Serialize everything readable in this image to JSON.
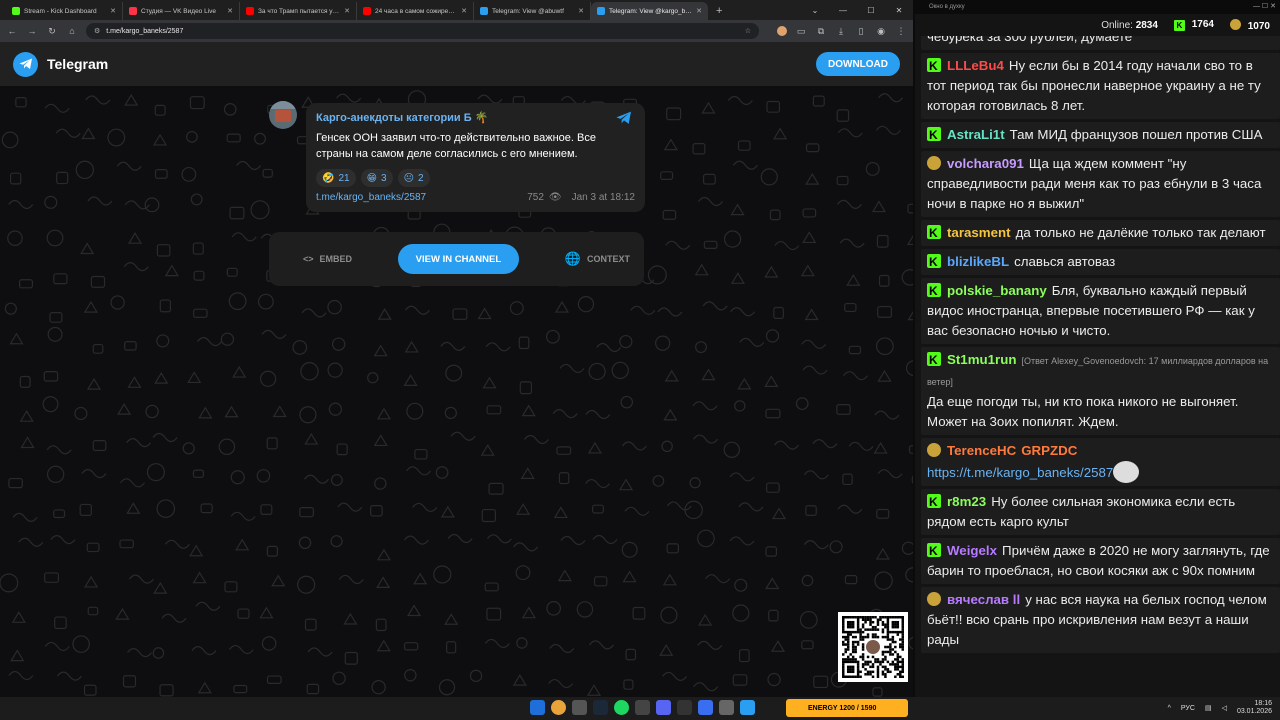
{
  "browser": {
    "tabs": [
      {
        "title": "Stream - Kick Dashboard",
        "color": "#53fc18",
        "active": false
      },
      {
        "title": "Студия — VK Видео Live",
        "color": "#ff3347",
        "active": false
      },
      {
        "title": "За что Трамп пытается убить",
        "color": "#ff0000",
        "active": false
      },
      {
        "title": "24 часа в самом сожиревшем",
        "color": "#ff0000",
        "active": false
      },
      {
        "title": "Telegram: View @abuwtf",
        "color": "#2a9ef1",
        "active": false
      },
      {
        "title": "Telegram: View @kargo_baneks",
        "color": "#2a9ef1",
        "active": true
      }
    ],
    "url": "t.me/kargo_baneks/2587"
  },
  "telegram": {
    "brand": "Telegram",
    "download_label": "DOWNLOAD",
    "post": {
      "channel": "Карго-анекдоты категории Б 🌴",
      "text": "Генсек ООН заявил что-то действительно важное. Все страны на самом деле согласились с его мнением.",
      "reactions": [
        {
          "emoji": "🤣",
          "count": "21"
        },
        {
          "emoji": "😁",
          "count": "3"
        },
        {
          "emoji": "😐",
          "count": "2"
        }
      ],
      "link": "t.me/kargo_baneks/2587",
      "views": "752",
      "date": "Jan 3 at 18:12"
    },
    "actions": {
      "embed": "EMBED",
      "view": "VIEW IN CHANNEL",
      "context": "CONTEXT"
    }
  },
  "chat": {
    "window_title": "Окно в духку",
    "online_label": "Online:",
    "online_count": "2834",
    "kick_count": "1764",
    "other_count": "1070",
    "messages": [
      {
        "badge": "kick",
        "user": "",
        "color": "#ffffff",
        "reply": "",
        "text": "чебурека за 300 рублей, думаете"
      },
      {
        "badge": "kick",
        "user": "LLLeBu4",
        "color": "#ff4a4a",
        "reply": "",
        "text": "Ну если бы в 2014 году начали сво то в тот период так бы пронесли наверное украину а не ту которая готовилась 8 лет."
      },
      {
        "badge": "kick",
        "user": "AstraLi1t",
        "color": "#66e3c4",
        "reply": "",
        "text": "Там МИД французов пошел против США"
      },
      {
        "badge": "pig",
        "user": "volchara091",
        "color": "#c79bff",
        "reply": "",
        "text": "Ща ща ждем коммент \"ну справедливости ради меня как то раз ебнули в 3 часа ночи в парке но я выжил\""
      },
      {
        "badge": "kick",
        "user": "tarasment",
        "color": "#f5c542",
        "reply": "",
        "text": "да только не далёкие только так делают"
      },
      {
        "badge": "kick",
        "user": "blizlikeBL",
        "color": "#5aa8ff",
        "reply": "",
        "text": "славься автоваз"
      },
      {
        "badge": "kick",
        "user": "polskie_banany",
        "color": "#8cff5a",
        "reply": "",
        "text": "Бля, буквально каждый первый видос иностранца, впервые посетившего РФ — как у вас безопасно ночью и чисто."
      },
      {
        "badge": "kick",
        "user": "St1mu1run",
        "color": "#8cff5a",
        "reply": "[Ответ Alexey_Govenoedovch: 17 миллиардов долларов на ветер]",
        "text": "Да еще погоди ты, ни кто пока никого не выгоняет. Может на 3оих попилят. Ждем."
      },
      {
        "badge": "pig",
        "user": "TerenceHC",
        "color": "#ff7a3d",
        "reply": "",
        "text": "GRPZDC",
        "text_color": "#ff7a3d",
        "link": "https://t.me/kargo_baneks/2587"
      },
      {
        "badge": "kick",
        "user": "r8m23",
        "color": "#8cff5a",
        "reply": "",
        "text": "Ну более сильная экономика если есть рядом есть карго культ"
      },
      {
        "badge": "kick",
        "user": "Weigelx",
        "color": "#b77bff",
        "reply": "",
        "text": "Причём даже в 2020 не могу заглянуть, где барин то проеблася, но свои косяки аж с 90х помним"
      },
      {
        "badge": "pig",
        "user": "вячеслав ll",
        "color": "#b77bff",
        "reply": "",
        "text": "у нас вся наука на белых господ челом бьёт!! всю срань про искривления нам везут а наши рады"
      }
    ]
  },
  "taskbar": {
    "banner": "ENERGY 1200 / 1590",
    "lang": "РУС",
    "time": "18:16",
    "date": "03.01.2026"
  }
}
